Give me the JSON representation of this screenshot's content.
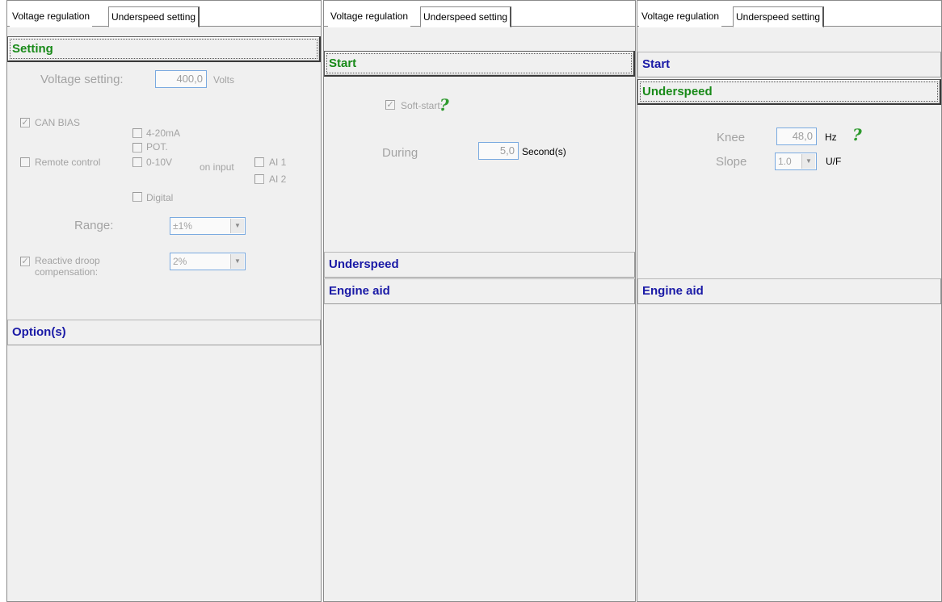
{
  "panel1": {
    "tabs": [
      "Voltage regulation",
      "Underspeed setting"
    ],
    "setting_header": "Setting",
    "voltage_label": "Voltage setting:",
    "voltage_value": "400,0",
    "voltage_unit": "Volts",
    "can_bias": "CAN BIAS",
    "remote_control": "Remote control",
    "opt_4_20": "4-20mA",
    "opt_pot": "POT.",
    "opt_0_10": "0-10V",
    "on_input": "on input",
    "ai1": "AI 1",
    "ai2": "AI 2",
    "digital": "Digital",
    "range_label": "Range:",
    "range_value": "±1%",
    "reactive_line1": "Reactive droop",
    "reactive_line2": "compensation:",
    "reactive_value": "2%",
    "options_header": "Option(s)"
  },
  "panel2": {
    "tabs": [
      "Voltage regulation",
      "Underspeed setting"
    ],
    "start_header": "Start",
    "soft_start": "Soft-start:",
    "help": "?",
    "during_label": "During",
    "during_value": "5,0",
    "during_unit": "Second(s)",
    "underspeed_header": "Underspeed",
    "engine_aid_header": "Engine aid"
  },
  "panel3": {
    "tabs": [
      "Voltage regulation",
      "Underspeed setting"
    ],
    "start_header": "Start",
    "underspeed_header": "Underspeed",
    "knee_label": "Knee",
    "knee_value": "48,0",
    "knee_unit": "Hz",
    "help": "?",
    "slope_label": "Slope",
    "slope_value": "1.0",
    "slope_unit": "U/F",
    "engine_aid_header": "Engine aid"
  },
  "checkmark": "✓",
  "dropdown_arrow": "▼",
  "colors": {
    "active_header": "#198a19",
    "inactive_header": "#1a1aa6",
    "disabled_text": "#a3a3a3",
    "help": "#2e9a2e"
  }
}
